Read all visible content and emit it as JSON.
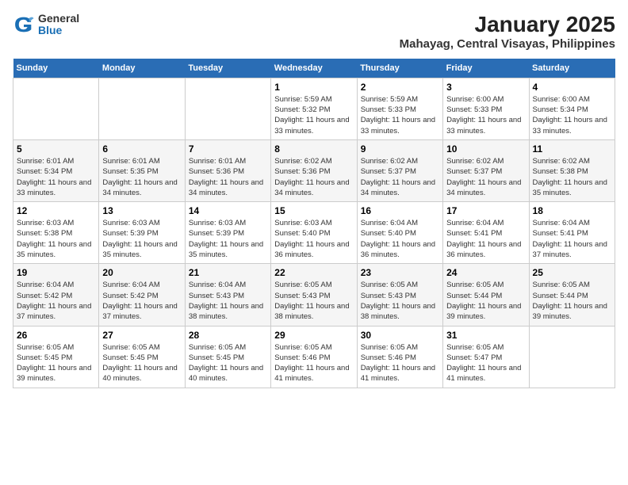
{
  "header": {
    "logo_line1": "General",
    "logo_line2": "Blue",
    "title": "January 2025",
    "subtitle": "Mahayag, Central Visayas, Philippines"
  },
  "days_of_week": [
    "Sunday",
    "Monday",
    "Tuesday",
    "Wednesday",
    "Thursday",
    "Friday",
    "Saturday"
  ],
  "weeks": [
    [
      {
        "day": "",
        "sunrise": "",
        "sunset": "",
        "daylight": ""
      },
      {
        "day": "",
        "sunrise": "",
        "sunset": "",
        "daylight": ""
      },
      {
        "day": "",
        "sunrise": "",
        "sunset": "",
        "daylight": ""
      },
      {
        "day": "1",
        "sunrise": "Sunrise: 5:59 AM",
        "sunset": "Sunset: 5:32 PM",
        "daylight": "Daylight: 11 hours and 33 minutes."
      },
      {
        "day": "2",
        "sunrise": "Sunrise: 5:59 AM",
        "sunset": "Sunset: 5:33 PM",
        "daylight": "Daylight: 11 hours and 33 minutes."
      },
      {
        "day": "3",
        "sunrise": "Sunrise: 6:00 AM",
        "sunset": "Sunset: 5:33 PM",
        "daylight": "Daylight: 11 hours and 33 minutes."
      },
      {
        "day": "4",
        "sunrise": "Sunrise: 6:00 AM",
        "sunset": "Sunset: 5:34 PM",
        "daylight": "Daylight: 11 hours and 33 minutes."
      }
    ],
    [
      {
        "day": "5",
        "sunrise": "Sunrise: 6:01 AM",
        "sunset": "Sunset: 5:34 PM",
        "daylight": "Daylight: 11 hours and 33 minutes."
      },
      {
        "day": "6",
        "sunrise": "Sunrise: 6:01 AM",
        "sunset": "Sunset: 5:35 PM",
        "daylight": "Daylight: 11 hours and 34 minutes."
      },
      {
        "day": "7",
        "sunrise": "Sunrise: 6:01 AM",
        "sunset": "Sunset: 5:36 PM",
        "daylight": "Daylight: 11 hours and 34 minutes."
      },
      {
        "day": "8",
        "sunrise": "Sunrise: 6:02 AM",
        "sunset": "Sunset: 5:36 PM",
        "daylight": "Daylight: 11 hours and 34 minutes."
      },
      {
        "day": "9",
        "sunrise": "Sunrise: 6:02 AM",
        "sunset": "Sunset: 5:37 PM",
        "daylight": "Daylight: 11 hours and 34 minutes."
      },
      {
        "day": "10",
        "sunrise": "Sunrise: 6:02 AM",
        "sunset": "Sunset: 5:37 PM",
        "daylight": "Daylight: 11 hours and 34 minutes."
      },
      {
        "day": "11",
        "sunrise": "Sunrise: 6:02 AM",
        "sunset": "Sunset: 5:38 PM",
        "daylight": "Daylight: 11 hours and 35 minutes."
      }
    ],
    [
      {
        "day": "12",
        "sunrise": "Sunrise: 6:03 AM",
        "sunset": "Sunset: 5:38 PM",
        "daylight": "Daylight: 11 hours and 35 minutes."
      },
      {
        "day": "13",
        "sunrise": "Sunrise: 6:03 AM",
        "sunset": "Sunset: 5:39 PM",
        "daylight": "Daylight: 11 hours and 35 minutes."
      },
      {
        "day": "14",
        "sunrise": "Sunrise: 6:03 AM",
        "sunset": "Sunset: 5:39 PM",
        "daylight": "Daylight: 11 hours and 35 minutes."
      },
      {
        "day": "15",
        "sunrise": "Sunrise: 6:03 AM",
        "sunset": "Sunset: 5:40 PM",
        "daylight": "Daylight: 11 hours and 36 minutes."
      },
      {
        "day": "16",
        "sunrise": "Sunrise: 6:04 AM",
        "sunset": "Sunset: 5:40 PM",
        "daylight": "Daylight: 11 hours and 36 minutes."
      },
      {
        "day": "17",
        "sunrise": "Sunrise: 6:04 AM",
        "sunset": "Sunset: 5:41 PM",
        "daylight": "Daylight: 11 hours and 36 minutes."
      },
      {
        "day": "18",
        "sunrise": "Sunrise: 6:04 AM",
        "sunset": "Sunset: 5:41 PM",
        "daylight": "Daylight: 11 hours and 37 minutes."
      }
    ],
    [
      {
        "day": "19",
        "sunrise": "Sunrise: 6:04 AM",
        "sunset": "Sunset: 5:42 PM",
        "daylight": "Daylight: 11 hours and 37 minutes."
      },
      {
        "day": "20",
        "sunrise": "Sunrise: 6:04 AM",
        "sunset": "Sunset: 5:42 PM",
        "daylight": "Daylight: 11 hours and 37 minutes."
      },
      {
        "day": "21",
        "sunrise": "Sunrise: 6:04 AM",
        "sunset": "Sunset: 5:43 PM",
        "daylight": "Daylight: 11 hours and 38 minutes."
      },
      {
        "day": "22",
        "sunrise": "Sunrise: 6:05 AM",
        "sunset": "Sunset: 5:43 PM",
        "daylight": "Daylight: 11 hours and 38 minutes."
      },
      {
        "day": "23",
        "sunrise": "Sunrise: 6:05 AM",
        "sunset": "Sunset: 5:43 PM",
        "daylight": "Daylight: 11 hours and 38 minutes."
      },
      {
        "day": "24",
        "sunrise": "Sunrise: 6:05 AM",
        "sunset": "Sunset: 5:44 PM",
        "daylight": "Daylight: 11 hours and 39 minutes."
      },
      {
        "day": "25",
        "sunrise": "Sunrise: 6:05 AM",
        "sunset": "Sunset: 5:44 PM",
        "daylight": "Daylight: 11 hours and 39 minutes."
      }
    ],
    [
      {
        "day": "26",
        "sunrise": "Sunrise: 6:05 AM",
        "sunset": "Sunset: 5:45 PM",
        "daylight": "Daylight: 11 hours and 39 minutes."
      },
      {
        "day": "27",
        "sunrise": "Sunrise: 6:05 AM",
        "sunset": "Sunset: 5:45 PM",
        "daylight": "Daylight: 11 hours and 40 minutes."
      },
      {
        "day": "28",
        "sunrise": "Sunrise: 6:05 AM",
        "sunset": "Sunset: 5:45 PM",
        "daylight": "Daylight: 11 hours and 40 minutes."
      },
      {
        "day": "29",
        "sunrise": "Sunrise: 6:05 AM",
        "sunset": "Sunset: 5:46 PM",
        "daylight": "Daylight: 11 hours and 41 minutes."
      },
      {
        "day": "30",
        "sunrise": "Sunrise: 6:05 AM",
        "sunset": "Sunset: 5:46 PM",
        "daylight": "Daylight: 11 hours and 41 minutes."
      },
      {
        "day": "31",
        "sunrise": "Sunrise: 6:05 AM",
        "sunset": "Sunset: 5:47 PM",
        "daylight": "Daylight: 11 hours and 41 minutes."
      },
      {
        "day": "",
        "sunrise": "",
        "sunset": "",
        "daylight": ""
      }
    ]
  ]
}
